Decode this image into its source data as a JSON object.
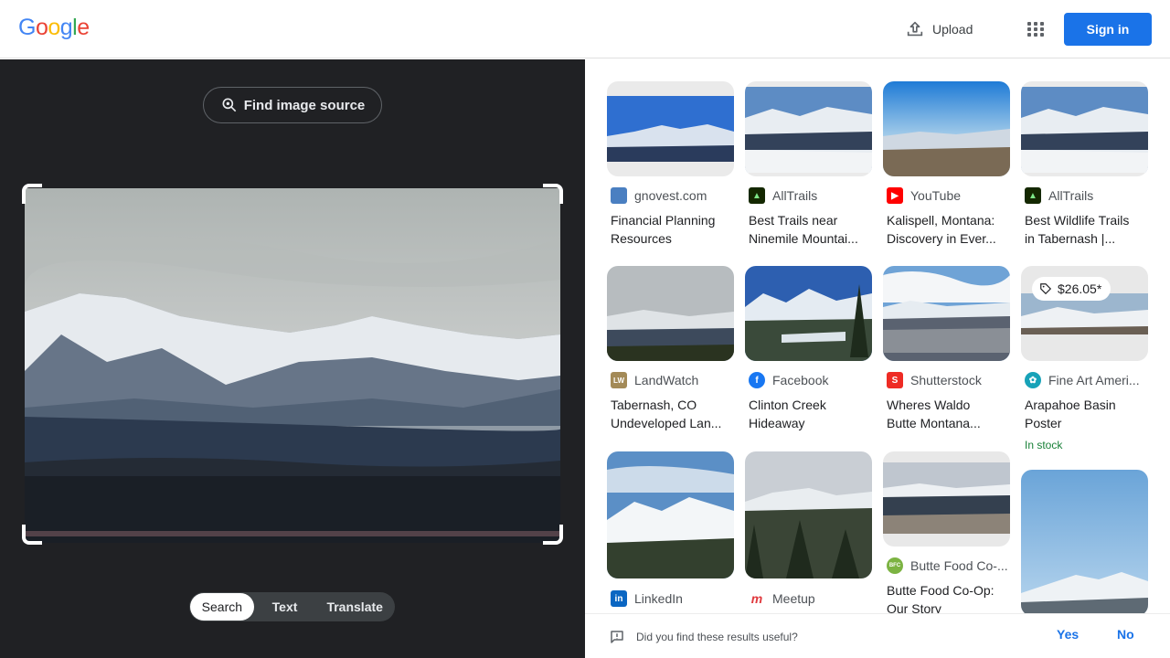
{
  "header": {
    "logo": [
      "G",
      "o",
      "o",
      "g",
      "l",
      "e"
    ],
    "logo_colors": [
      "#4285F4",
      "#EA4335",
      "#FBBC05",
      "#4285F4",
      "#34A853",
      "#EA4335"
    ],
    "upload_label": "Upload",
    "apps_icon": "apps-grid-icon",
    "signin_label": "Sign in"
  },
  "lens": {
    "find_source_label": "Find image source",
    "modes": [
      "Search",
      "Text",
      "Translate"
    ],
    "active_mode": "Search"
  },
  "results": [
    {
      "source": "gnovest.com",
      "title": [
        "Financial Planning",
        "Resources"
      ],
      "favicon": "chart-favicon",
      "favicon_color": "#4a7fc1"
    },
    {
      "source": "AllTrails",
      "title": [
        "Best Trails near",
        "Ninemile Mountai..."
      ],
      "favicon": "alltrails-favicon",
      "favicon_color": "#142800"
    },
    {
      "source": "YouTube",
      "title": [
        "Kalispell, Montana:",
        "Discovery in Ever..."
      ],
      "favicon": "youtube-favicon",
      "favicon_color": "#ff0000"
    },
    {
      "source": "AllTrails",
      "title": [
        "Best Wildlife Trails",
        "in Tabernash |..."
      ],
      "favicon": "alltrails-favicon",
      "favicon_color": "#142800"
    },
    {
      "source": "LandWatch",
      "title": [
        "Tabernash, CO",
        "Undeveloped Lan..."
      ],
      "favicon": "landwatch-favicon",
      "favicon_color": "#a38a57",
      "favicon_text": "LW"
    },
    {
      "source": "Facebook",
      "title": [
        "Clinton Creek",
        "Hideaway"
      ],
      "favicon": "facebook-favicon",
      "favicon_color": "#1877f2"
    },
    {
      "source": "Shutterstock",
      "title": [
        "Wheres Waldo",
        "Butte Montana..."
      ],
      "favicon": "shutterstock-favicon",
      "favicon_color": "#ee2b24"
    },
    {
      "source": "Fine Art Ameri...",
      "title": [
        "Arapahoe Basin",
        "Poster"
      ],
      "favicon": "fineartamerica-favicon",
      "favicon_color": "#17a2b8",
      "price": "$26.05*",
      "stock": "In stock"
    },
    {
      "source": "LinkedIn",
      "title": [],
      "favicon": "linkedin-favicon",
      "favicon_color": "#0a66c2"
    },
    {
      "source": "Meetup",
      "title": [],
      "favicon": "meetup-favicon",
      "favicon_color": "#e0393e"
    },
    {
      "source": "Butte Food Co-...",
      "title": [
        "Butte Food Co-Op:",
        "Our Story"
      ],
      "favicon": "buttefood-favicon",
      "favicon_color": "#7cb342",
      "favicon_text": "BFC"
    }
  ],
  "feedback": {
    "question": "Did you find these results useful?",
    "yes": "Yes",
    "no": "No"
  }
}
